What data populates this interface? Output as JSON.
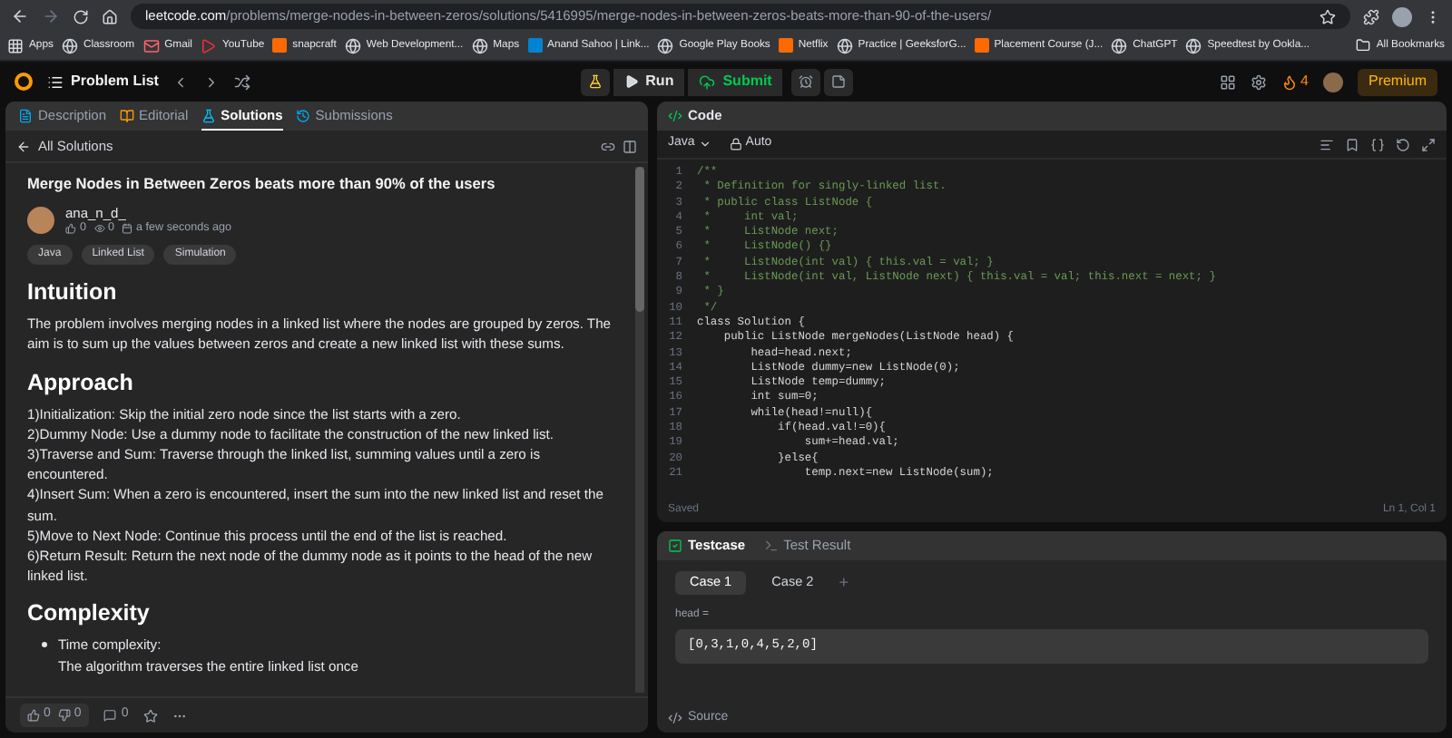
{
  "browser": {
    "url_host": "leetcode.com",
    "url_path": "/problems/merge-nodes-in-between-zeros/solutions/5416995/merge-nodes-in-between-zeros-beats-more-than-90-of-the-users/",
    "bookmarks": [
      {
        "label": "Apps",
        "kind": "grid"
      },
      {
        "label": "Classroom",
        "kind": "globe"
      },
      {
        "label": "Gmail",
        "kind": "mail"
      },
      {
        "label": "YouTube",
        "kind": "play"
      },
      {
        "label": "snapcraft",
        "kind": "box"
      },
      {
        "label": "Web Development...",
        "kind": "globe"
      },
      {
        "label": "Maps",
        "kind": "globe"
      },
      {
        "label": "Anand Sahoo | Link...",
        "kind": "in"
      },
      {
        "label": "Google Play Books",
        "kind": "globe"
      },
      {
        "label": "Netflix",
        "kind": "box"
      },
      {
        "label": "Practice | GeeksforG...",
        "kind": "globe"
      },
      {
        "label": "Placement Course (J...",
        "kind": "box"
      },
      {
        "label": "ChatGPT",
        "kind": "globe"
      },
      {
        "label": "Speedtest by Ookla...",
        "kind": "globe"
      }
    ],
    "all_bookmarks": "All Bookmarks"
  },
  "nav": {
    "problem_list": "Problem List",
    "run": "Run",
    "submit": "Submit",
    "streak": "4",
    "premium": "Premium"
  },
  "left": {
    "tabs": [
      {
        "label": "Description",
        "selected": false
      },
      {
        "label": "Editorial",
        "selected": false
      },
      {
        "label": "Solutions",
        "selected": true
      },
      {
        "label": "Submissions",
        "selected": false
      }
    ],
    "back": "All Solutions",
    "title": "Merge Nodes in Between Zeros beats more than 90% of the users",
    "author": "ana_n_d_",
    "stats": [
      "0",
      "0"
    ],
    "time": "a few seconds ago",
    "tags": [
      "Java",
      "Linked List",
      "Simulation"
    ],
    "sections": [
      {
        "heading": "Intuition",
        "kind": "paragraph",
        "lines": [
          "The problem involves merging nodes in a linked list where the nodes are grouped by zeros. The aim is to sum up the values between zeros and create a new linked list with these sums."
        ]
      },
      {
        "heading": "Approach",
        "kind": "paragraph",
        "lines": [
          "1)Initialization: Skip the initial zero node since the list starts with a zero.",
          "2)Dummy Node: Use a dummy node to facilitate the construction of the new linked list.",
          "3)Traverse and Sum: Traverse through the linked list, summing values until a zero is encountered.",
          "4)Insert Sum: When a zero is encountered, insert the sum into the new linked list and reset the sum.",
          "5)Move to Next Node: Continue this process until the end of the list is reached.",
          "6)Return Result: Return the next node of the dummy node as it points to the head of the new linked list."
        ]
      },
      {
        "heading": "Complexity",
        "kind": "bullets",
        "lines": [
          "Time complexity:",
          "The algorithm traverses the entire linked list once"
        ]
      }
    ],
    "upvotes": "0",
    "downvotes": "0",
    "comments": "0"
  },
  "code": {
    "title": "Code",
    "language": "Java",
    "mode": "Auto",
    "lines": [
      {
        "n": "1",
        "kind": "comment",
        "text": "/**"
      },
      {
        "n": "2",
        "kind": "comment",
        "text": " * Definition for singly-linked list."
      },
      {
        "n": "3",
        "kind": "comment",
        "text": " * public class ListNode {"
      },
      {
        "n": "4",
        "kind": "comment",
        "text": " *     int val;"
      },
      {
        "n": "5",
        "kind": "comment",
        "text": " *     ListNode next;"
      },
      {
        "n": "6",
        "kind": "comment",
        "text": " *     ListNode() {}"
      },
      {
        "n": "7",
        "kind": "comment",
        "text": " *     ListNode(int val) { this.val = val; }"
      },
      {
        "n": "8",
        "kind": "comment",
        "text": " *     ListNode(int val, ListNode next) { this.val = val; this.next = next; }"
      },
      {
        "n": "9",
        "kind": "comment",
        "text": " * }"
      },
      {
        "n": "10",
        "kind": "comment",
        "text": " */"
      },
      {
        "n": "11",
        "kind": "code",
        "text": "class Solution {"
      },
      {
        "n": "12",
        "kind": "code",
        "text": "    public ListNode mergeNodes(ListNode head) {"
      },
      {
        "n": "13",
        "kind": "code",
        "text": "        head=head.next;"
      },
      {
        "n": "14",
        "kind": "code",
        "text": "        ListNode dummy=new ListNode(0);"
      },
      {
        "n": "15",
        "kind": "code",
        "text": "        ListNode temp=dummy;"
      },
      {
        "n": "16",
        "kind": "code",
        "text": "        int sum=0;"
      },
      {
        "n": "17",
        "kind": "code",
        "text": "        while(head!=null){"
      },
      {
        "n": "18",
        "kind": "code",
        "text": "            if(head.val!=0){"
      },
      {
        "n": "19",
        "kind": "code",
        "text": "                sum+=head.val;"
      },
      {
        "n": "20",
        "kind": "code",
        "text": "            }else{"
      },
      {
        "n": "21",
        "kind": "code",
        "text": "                temp.next=new ListNode(sum);"
      }
    ],
    "status": "Saved",
    "cursor": "Ln 1, Col 1"
  },
  "testcase": {
    "tabs": [
      {
        "label": "Testcase",
        "selected": true
      },
      {
        "label": "Test Result",
        "selected": false
      }
    ],
    "cases": [
      {
        "label": "Case 1",
        "selected": true
      },
      {
        "label": "Case 2",
        "selected": false
      }
    ],
    "add": "+",
    "param": "head =",
    "value": "[0,3,1,0,4,5,2,0]",
    "source": "Source"
  }
}
